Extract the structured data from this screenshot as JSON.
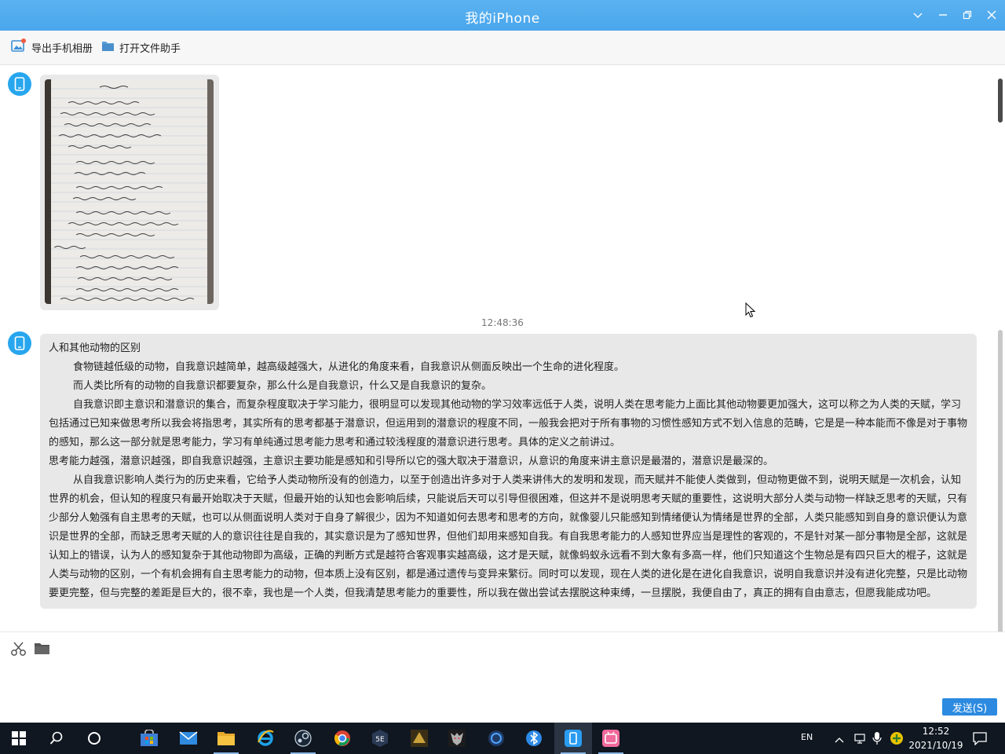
{
  "window": {
    "title": "我的iPhone",
    "accent": "#4aa6ec"
  },
  "toolbar": {
    "export_album": "导出手机相册",
    "open_file_helper": "打开文件助手"
  },
  "chat": {
    "messages": [
      {
        "type": "image",
        "sender": "phone"
      },
      {
        "timestamp": "12:48:36"
      },
      {
        "type": "text",
        "sender": "phone",
        "paragraphs": [
          "人和其他动物的区别",
          "食物链越低级的动物，自我意识越简单，越高级越强大，从进化的角度来看，自我意识从侧面反映出一个生命的进化程度。",
          "而人类比所有的动物的自我意识都要复杂，那么什么是自我意识，什么又是自我意识的复杂。",
          "自我意识即主意识和潜意识的集合，而复杂程度取决于学习能力，很明显可以发现其他动物的学习效率远低于人类，说明人类在思考能力上面比其他动物要更加强大，这可以称之为人类的天赋，学习包括通过已知来做思考所以我会将指思考，其实所有的思考都基于潜意识，但运用到的潜意识的程度不同，一般我会把对于所有事物的习惯性感知方式不划入信息的范畴，它是是一种本能而不像是对于事物的感知，那么这一部分就是思考能力，学习有单纯通过思考能力思考和通过较浅程度的潜意识进行思考。具体的定义之前讲过。",
          "思考能力越强，潜意识越强，即自我意识越强，主意识主要功能是感知和引导所以它的强大取决于潜意识，从意识的角度来讲主意识是最潜的，潜意识是最深的。",
          "从自我意识影响人类行为的历史来看，它给予人类动物所没有的创造力，以至于创造出许多对于人类来讲伟大的发明和发现，而天赋并不能使人类做到，但动物更做不到，说明天赋是一次机会，认知世界的机会，但认知的程度只有最开始取决于天赋，但最开始的认知也会影响后续，只能说后天可以引导但很困难，但这并不是说明思考天赋的重要性，这说明大部分人类与动物一样缺乏思考的天赋，只有少部分人勉强有自主思考的天赋，也可以从侧面说明人类对于自身了解很少，因为不知道如何去思考和思考的方向，就像婴儿只能感知到情绪便认为情绪是世界的全部，人类只能感知到自身的意识便认为意识是世界的全部，而缺乏思考天赋的人的意识往往是自我的，其实意识是为了感知世界，但他们却用来感知自我。有自我思考能力的人感知世界应当是理性的客观的，不是针对某一部分事物是全部，这就是认知上的错误，认为人的感知复杂于其他动物即为高级，正确的判断方式是越符合客观事实越高级，这才是天赋，就像蚂蚁永远看不到大象有多高一样，他们只知道这个生物总是有四只巨大的棍子，这就是人类与动物的区别，一个有机会拥有自主思考能力的动物，但本质上没有区别，都是通过遗传与变异来繁衍。同时可以发现，现在人类的进化是在进化自我意识，说明自我意识并没有进化完整，只是比动物要更完整，但与完整的差距是巨大的，很不幸，我也是一个人类，但我清楚思考能力的重要性，所以我在做出尝试去摆脱这种束缚，一旦摆脱，我便自由了，真正的拥有自由意志，但愿我能成功吧。"
        ]
      }
    ]
  },
  "input": {
    "send_label": "发送(S)"
  },
  "taskbar": {
    "lang": "EN",
    "time": "12:52",
    "date": "2021/10/19"
  }
}
